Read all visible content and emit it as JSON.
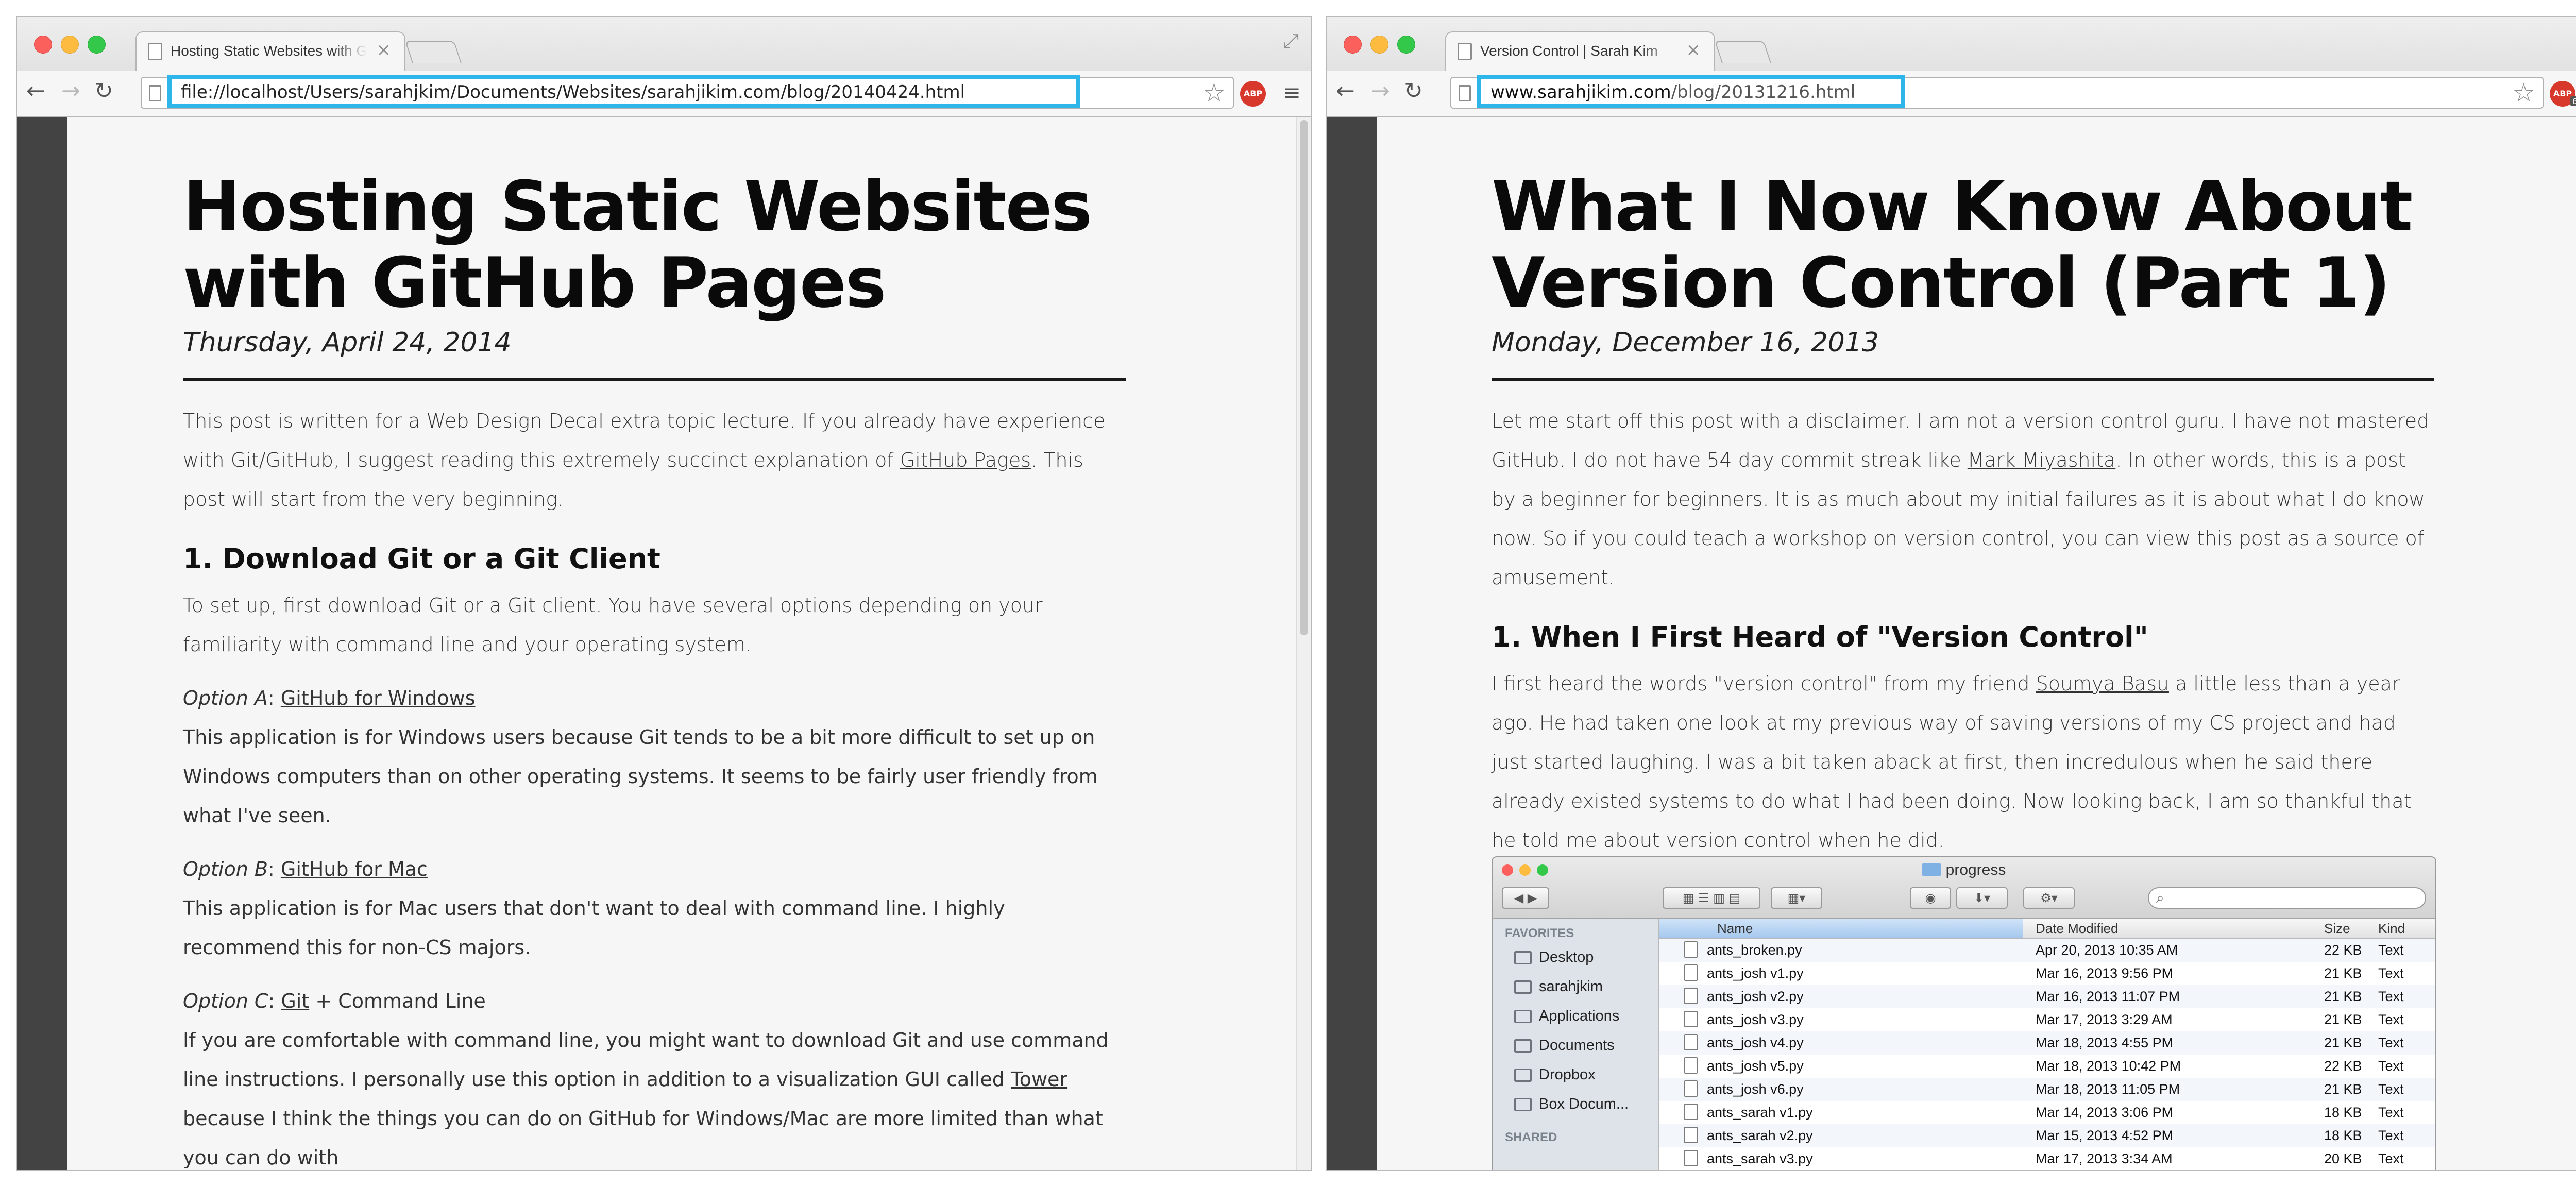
{
  "left": {
    "tab_title": "Hosting Static Websites with GitHub Pages",
    "url": "file://localhost/Users/sarahjkim/Documents/Websites/sarahjikim.com/blog/20140424.html",
    "title_line1": "Hosting Static Websites",
    "title_line2": "with GitHub Pages",
    "date": "Thursday, April 24, 2014",
    "intro_1": "This post is written for a Web Design Decal extra topic lecture. If you already have experience with Git/GitHub, I suggest reading this extremely succinct explanation of ",
    "intro_link": "GitHub Pages",
    "intro_2": ". This post will start from the very beginning.",
    "h2": "1. Download Git or a Git Client",
    "setup_para": "To set up, first download Git or a Git client. You have several options depending on your familiarity with command line and your operating system.",
    "opt_a_label": "Option A",
    "opt_a_link": "GitHub for Windows",
    "opt_a_para": "This application is for Windows users because Git tends to be a bit more difficult to set up on Windows computers than on other operating systems. It seems to be fairly user friendly from what I've seen.",
    "opt_b_label": "Option B",
    "opt_b_link": "GitHub for Mac",
    "opt_b_para": "This application is for Mac users that don't want to deal with command line. I highly recommend this for non-CS majors.",
    "opt_c_label": "Option C",
    "opt_c_link": "Git",
    "opt_c_suffix": " + Command Line",
    "opt_c_para_1": "If you are comfortable with command line, you might want to download Git and use command line instructions. I personally use this option in addition to a visualization GUI called ",
    "opt_c_para_link": "Tower",
    "opt_c_para_2": " because I think the things you can do on GitHub for Windows/Mac are more limited than what you can do with"
  },
  "right": {
    "tab_title": "Version Control | Sarah Kim",
    "url_domain": "www.sarahjikim.com",
    "url_path": "/blog/20131216.html",
    "abp_badge": "6",
    "title_line1": "What I Now Know About",
    "title_line2": "Version Control (Part 1)",
    "date": "Monday, December 16, 2013",
    "intro_1": "Let me start off this post with a disclaimer. I am not a version control guru. I have not mastered GitHub. I do not have 54 day commit streak like ",
    "intro_link": "Mark Miyashita",
    "intro_2": ". In other words, this is a post by a beginner for beginners. It is as much about my initial failures as it is about what I do know now. So if you could teach a workshop on version control, you can view this post as a source of amusement.",
    "h2": "1. When I First Heard of \"Version Control\"",
    "para2_1": "I first heard the words \"version control\" from my friend ",
    "para2_link": "Soumya Basu",
    "para2_2": " a little less than a year ago. He had taken one look at my previous way of saving versions of my CS project and had just started laughing. I was a bit taken aback at first, then incredulous when he said there already existed systems to do what I had been doing. Now looking back, I am so thankful that he told me about version control when he did.",
    "finder": {
      "title": "progress",
      "favorites_label": "FAVORITES",
      "shared_label": "SHARED",
      "sidebar": [
        "Desktop",
        "sarahjkim",
        "Applications",
        "Documents",
        "Dropbox",
        "Box Docum..."
      ],
      "columns": [
        "Name",
        "Date Modified",
        "Size",
        "Kind"
      ],
      "rows": [
        {
          "name": "ants_broken.py",
          "date": "Apr 20, 2013 10:35 AM",
          "size": "22 KB",
          "kind": "Text"
        },
        {
          "name": "ants_josh v1.py",
          "date": "Mar 16, 2013 9:56 PM",
          "size": "21 KB",
          "kind": "Text"
        },
        {
          "name": "ants_josh v2.py",
          "date": "Mar 16, 2013 11:07 PM",
          "size": "21 KB",
          "kind": "Text"
        },
        {
          "name": "ants_josh v3.py",
          "date": "Mar 17, 2013 3:29 AM",
          "size": "21 KB",
          "kind": "Text"
        },
        {
          "name": "ants_josh v4.py",
          "date": "Mar 18, 2013 4:55 PM",
          "size": "21 KB",
          "kind": "Text"
        },
        {
          "name": "ants_josh v5.py",
          "date": "Mar 18, 2013 10:42 PM",
          "size": "22 KB",
          "kind": "Text"
        },
        {
          "name": "ants_josh v6.py",
          "date": "Mar 18, 2013 11:05 PM",
          "size": "21 KB",
          "kind": "Text"
        },
        {
          "name": "ants_sarah v1.py",
          "date": "Mar 14, 2013 3:06 PM",
          "size": "18 KB",
          "kind": "Text"
        },
        {
          "name": "ants_sarah v2.py",
          "date": "Mar 15, 2013 4:52 PM",
          "size": "18 KB",
          "kind": "Text"
        },
        {
          "name": "ants_sarah v3.py",
          "date": "Mar 17, 2013 3:34 AM",
          "size": "20 KB",
          "kind": "Text"
        }
      ]
    }
  },
  "colors": {
    "url_highlight": "#2eb6ea",
    "sidebar_dark": "#434343",
    "abp_red": "#d8372b"
  },
  "icons": [
    "page-icon",
    "close-icon",
    "back-arrow-icon",
    "forward-arrow-icon",
    "reload-icon",
    "star-icon",
    "adblock-icon",
    "menu-icon",
    "fullscreen-icon",
    "folder-icon",
    "search-icon",
    "file-icon"
  ]
}
